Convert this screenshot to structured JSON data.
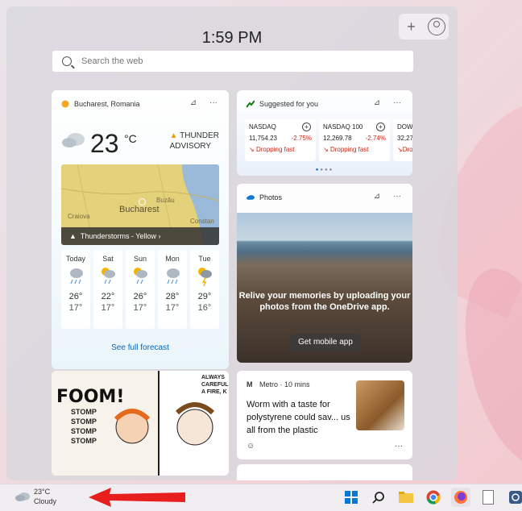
{
  "clock": {
    "time": "1:59 PM"
  },
  "toolbar": {
    "add": "+",
    "account_icon": "person-icon"
  },
  "search": {
    "placeholder": "Search the web"
  },
  "weather": {
    "location": "Bucharest, Romania",
    "temp": "23",
    "unit": "°C",
    "alert_line1": "THUNDER",
    "alert_line2": "ADVISORY",
    "map": {
      "city": "Bucharest",
      "labels": [
        "Buzău",
        "Craiova",
        "Constan"
      ],
      "bar": "Thunderstorms - Yellow"
    },
    "days": [
      {
        "name": "Today",
        "hi": "26°",
        "lo": "17°",
        "icon": "rain-cloud-icon"
      },
      {
        "name": "Sat",
        "hi": "22°",
        "lo": "17°",
        "icon": "sun-rain-icon"
      },
      {
        "name": "Sun",
        "hi": "26°",
        "lo": "17°",
        "icon": "sun-rain-icon"
      },
      {
        "name": "Mon",
        "hi": "28°",
        "lo": "17°",
        "icon": "rain-cloud-icon"
      },
      {
        "name": "Tue",
        "hi": "29°",
        "lo": "16°",
        "icon": "thunder-icon"
      }
    ],
    "forecast_link": "See full forecast"
  },
  "stocks": {
    "title": "Suggested for you",
    "items": [
      {
        "symbol": "NASDAQ",
        "value": "11,754.23",
        "change": "-2.75%",
        "status": "Dropping fast"
      },
      {
        "symbol": "NASDAQ 100",
        "value": "12,269.78",
        "change": "-2.74%",
        "status": "Dropping fast"
      },
      {
        "symbol": "DOW",
        "value": "32,27",
        "change": "",
        "status": "Dro"
      }
    ]
  },
  "photos": {
    "title": "Photos",
    "message": "Relive your memories by uploading your photos from the OneDrive app.",
    "button": "Get mobile app"
  },
  "comic": {
    "sound": "FOOM!",
    "stomp": "STOMP",
    "caption": "ALWAYS CAREFUL A FIRE, K"
  },
  "news": {
    "source": "Metro · 10 mins",
    "headline": "Worm with a taste for polystyrene could sav... us all from the plastic"
  },
  "taskbar": {
    "weather_temp": "23°C",
    "weather_desc": "Cloudy",
    "icons": [
      "windows-start-icon",
      "search-icon",
      "file-explorer-icon",
      "chrome-icon",
      "firefox-icon",
      "notepad-icon",
      "app-icon"
    ]
  },
  "colors": {
    "accent": "#0067c0",
    "negative": "#c42b1c",
    "arrow": "#e8201d"
  }
}
